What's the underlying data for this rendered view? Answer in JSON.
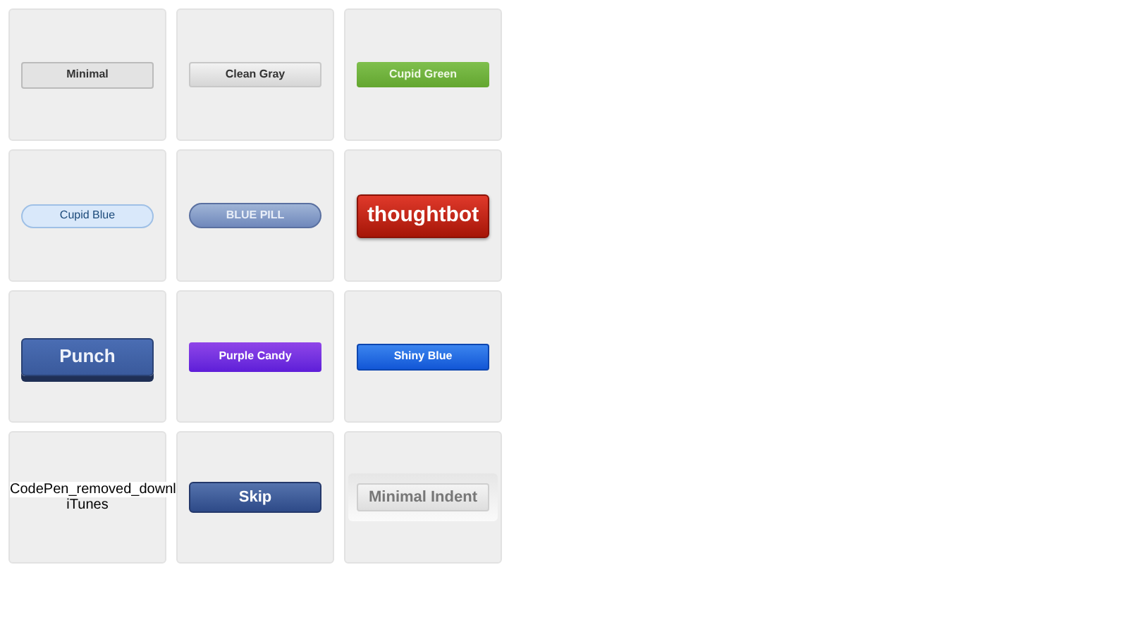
{
  "buttons": [
    {
      "kind": "minimal",
      "label": "Minimal"
    },
    {
      "kind": "clean-gray",
      "label": "Clean Gray"
    },
    {
      "kind": "cupid-green",
      "label": "Cupid Green"
    },
    {
      "kind": "cupid-blue",
      "label": "Cupid Blue"
    },
    {
      "kind": "blue-pill",
      "label": "BLUE PILL"
    },
    {
      "kind": "thoughtbot",
      "label": "thoughtbot"
    },
    {
      "kind": "punch",
      "label": "Punch"
    },
    {
      "kind": "purple-candy",
      "label": "Purple Candy"
    },
    {
      "kind": "shiny-blue",
      "label": "Shiny Blue"
    },
    {
      "kind": "broken-image",
      "label": "CodePen_removed_downl",
      "caption": "iTunes"
    },
    {
      "kind": "skip",
      "label": "Skip"
    },
    {
      "kind": "minimal-indent",
      "label": "Minimal Indent"
    }
  ]
}
